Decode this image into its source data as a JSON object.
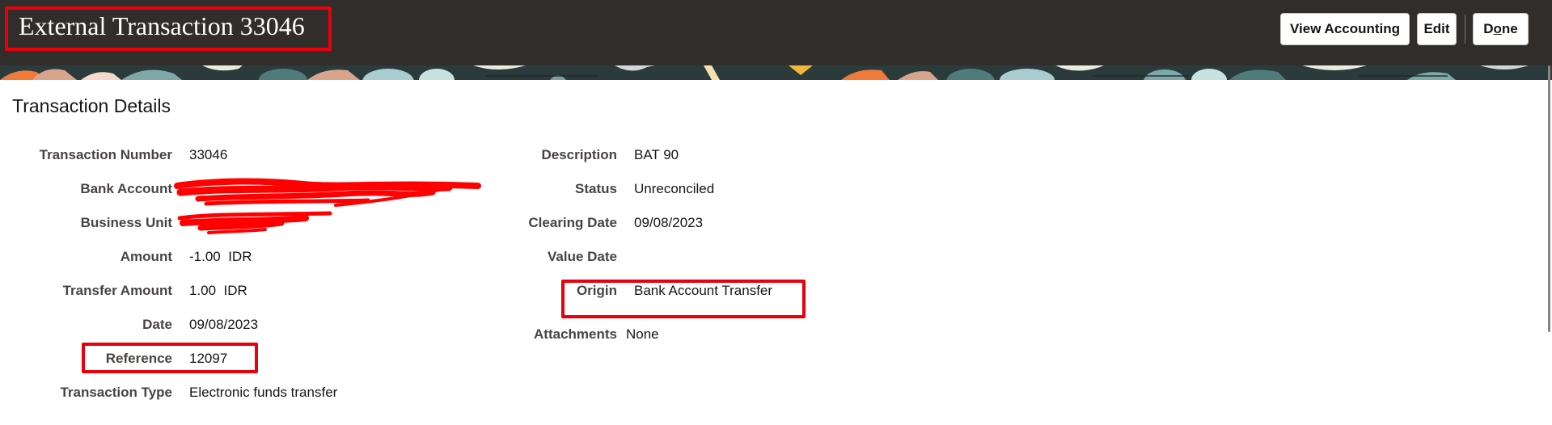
{
  "header": {
    "title": "External Transaction 33046",
    "buttons": {
      "view_accounting": "View Accounting",
      "edit": "Edit",
      "done_first": "D",
      "done_mnemonic": "o",
      "done_rest": "ne"
    }
  },
  "section": {
    "title": "Transaction Details"
  },
  "details_left": [
    {
      "label": "Transaction Number",
      "value": "33046"
    },
    {
      "label": "Bank Account",
      "value": ""
    },
    {
      "label": "Business Unit",
      "value": ""
    },
    {
      "label": "Amount",
      "value": "-1.00  IDR"
    },
    {
      "label": "Transfer Amount",
      "value": "1.00  IDR"
    },
    {
      "label": "Date",
      "value": "09/08/2023"
    },
    {
      "label": "Reference",
      "value": "12097"
    },
    {
      "label": "Transaction Type",
      "value": "Electronic funds transfer"
    }
  ],
  "details_right": [
    {
      "label": "Description",
      "value": "BAT 90"
    },
    {
      "label": "Status",
      "value": "Unreconciled"
    },
    {
      "label": "Clearing Date",
      "value": "09/08/2023"
    },
    {
      "label": "Value Date",
      "value": ""
    },
    {
      "label": "Origin",
      "value": "Bank Account Transfer"
    },
    {
      "label": "Attachments",
      "value": "None"
    }
  ],
  "colors": {
    "header_bg": "#312d2a",
    "highlight": "#e8000d",
    "redaction": "#ff0000"
  }
}
